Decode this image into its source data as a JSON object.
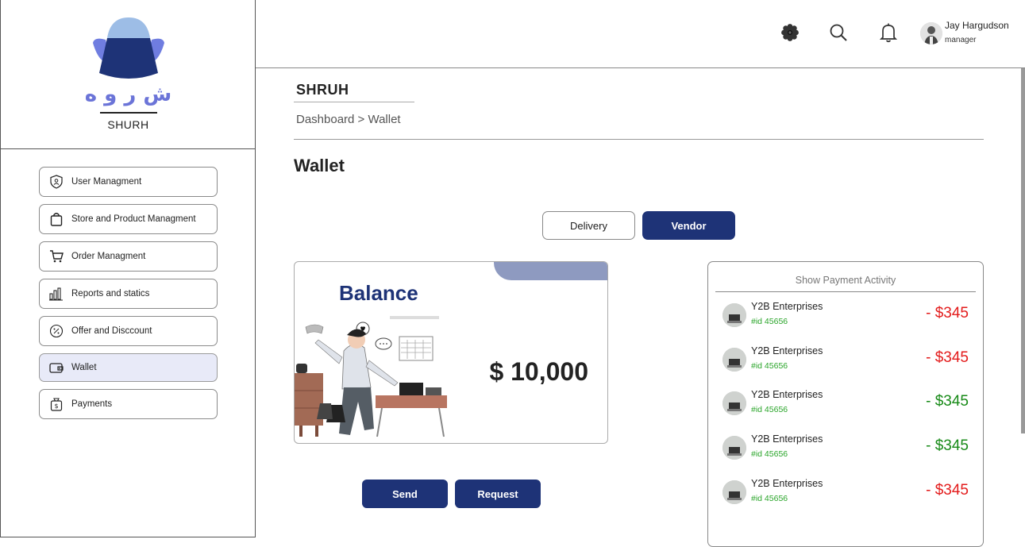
{
  "brand": {
    "arabic_name": "ش ر و ه",
    "name": "SHURH"
  },
  "sidebar": {
    "items": [
      {
        "label": "User Managment",
        "icon": "shield-user-icon"
      },
      {
        "label": "Store and Product Managment",
        "icon": "shopping-bag-icon"
      },
      {
        "label": "Order Managment",
        "icon": "cart-icon"
      },
      {
        "label": "Reports and statics",
        "icon": "bar-chart-icon"
      },
      {
        "label": "Offer and Disccount",
        "icon": "percent-icon"
      },
      {
        "label": "Wallet",
        "icon": "wallet-icon",
        "active": true
      },
      {
        "label": "Payments",
        "icon": "money-bag-icon"
      }
    ]
  },
  "header": {
    "icons": [
      "settings-icon",
      "search-icon",
      "bell-icon"
    ],
    "user": {
      "name": "Jay Hargudson",
      "role": "manager"
    }
  },
  "breadcrumb": {
    "title": "SHRUH",
    "path": "Dashboard > Wallet"
  },
  "page": {
    "title": "Wallet",
    "tabs": [
      {
        "label": "Delivery",
        "active": false
      },
      {
        "label": "Vendor",
        "active": true
      }
    ]
  },
  "balance": {
    "label": "Balance",
    "amount": "$ 10,000"
  },
  "actions": {
    "send": "Send",
    "request": "Request"
  },
  "activity": {
    "title": "Show Payment Activity",
    "items": [
      {
        "name": "Y2B Enterprises",
        "id": "#id 45656",
        "amount": "- $345",
        "color": "#e31b1b"
      },
      {
        "name": "Y2B Enterprises",
        "id": "#id 45656",
        "amount": "- $345",
        "color": "#e31b1b"
      },
      {
        "name": "Y2B Enterprises",
        "id": "#id 45656",
        "amount": "- $345",
        "color": "#178a17"
      },
      {
        "name": "Y2B Enterprises",
        "id": "#id 45656",
        "amount": "- $345",
        "color": "#178a17"
      },
      {
        "name": "Y2B Enterprises",
        "id": "#id 45656",
        "amount": "- $345",
        "color": "#e31b1b"
      }
    ]
  },
  "colors": {
    "primary": "#1e3377",
    "accent_light": "#8e9ac0",
    "negative": "#e31b1b",
    "positive": "#178a17",
    "id_green": "#2aa52a"
  }
}
